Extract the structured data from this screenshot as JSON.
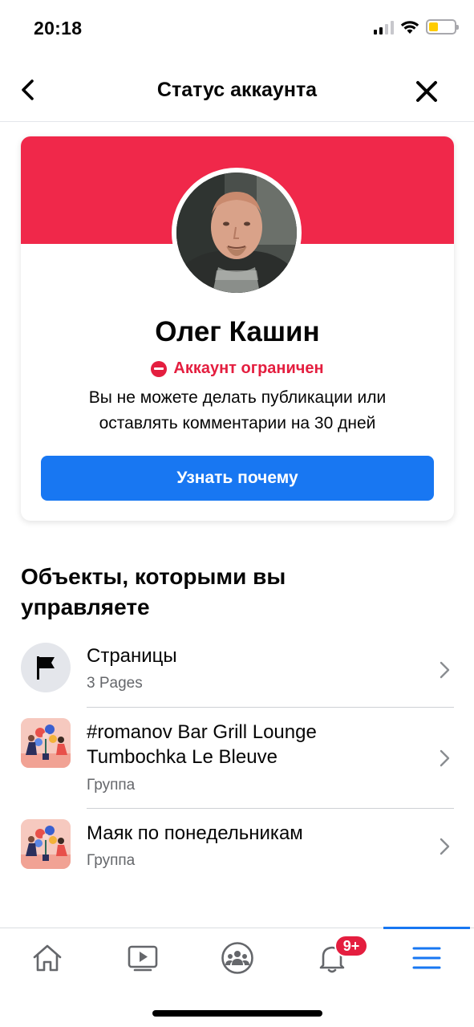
{
  "status_bar": {
    "time": "20:18"
  },
  "header": {
    "title": "Статус аккаунта",
    "back_icon": "chevron-left-icon",
    "close_icon": "close-icon"
  },
  "profile": {
    "banner_color": "#f0284a",
    "name": "Олег Кашин",
    "status": "Аккаунт ограничен",
    "description_line1": "Вы не можете делать публикации или",
    "description_line2": "оставлять комментарии на 30 дней",
    "button_label": "Узнать почему"
  },
  "managed": {
    "title_line1": "Объекты, которыми вы",
    "title_line2": "управляете",
    "items": [
      {
        "title_line1": "Страницы",
        "title_line2": "",
        "subtitle": "3 Pages",
        "icon": "flag-icon"
      },
      {
        "title_line1": "#romanov Bar Grill Lounge",
        "title_line2": "Tumbochka Le Bleuve",
        "subtitle": "Группа",
        "icon": "group-illustration"
      },
      {
        "title_line1": "Маяк по понедельникам",
        "title_line2": "",
        "subtitle": "Группа",
        "icon": "group-illustration"
      }
    ]
  },
  "tabbar": {
    "tabs": [
      "home-icon",
      "video-icon",
      "groups-icon",
      "notifications-icon",
      "menu-icon"
    ],
    "notification_badge": "9+",
    "active_color": "#1877f2"
  }
}
